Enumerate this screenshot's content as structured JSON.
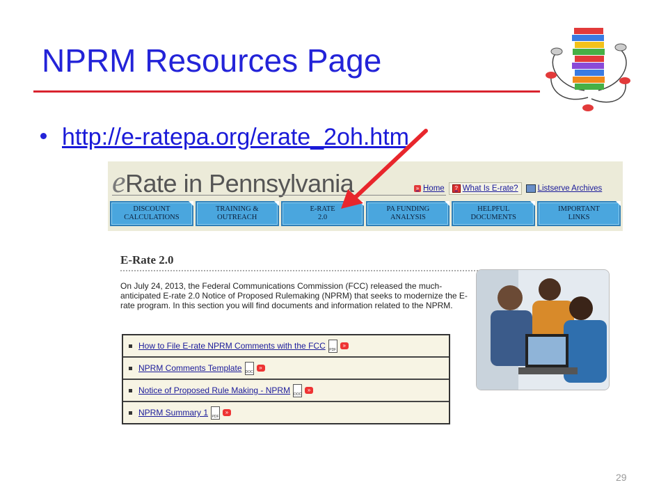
{
  "slide": {
    "title": "NPRM Resources Page",
    "bullet_link": "http://e-ratepa.org/erate_2oh.htm",
    "page_number": "29"
  },
  "site": {
    "logo_e": "e",
    "logo_rest": "Rate in Pennsylvania",
    "top_links": {
      "home": "Home",
      "what_is": "What Is E-rate?",
      "listserve": "Listserve Archives"
    },
    "nav": [
      "DISCOUNT\nCALCULATIONS",
      "TRAINING &\nOUTREACH",
      "E-RATE\n2.0",
      "PA FUNDING\nANALYSIS",
      "HELPFUL\nDOCUMENTS",
      "IMPORTANT\nLINKS"
    ],
    "heading": "E-Rate 2.0",
    "intro": "On July 24, 2013, the Federal Communications Commission (FCC) released the much-anticipated E-rate 2.0 Notice of Proposed Rulemaking (NPRM) that seeks to modernize the E-rate program. In this section you will find documents and information related to the NPRM.",
    "documents": [
      {
        "label": "How to File E-rate NPRM Comments with the FCC",
        "type": "PDF"
      },
      {
        "label": "NPRM Comments Template",
        "type": "DOC"
      },
      {
        "label": "Notice of Proposed Rule Making - NPRM",
        "type": "DOC"
      },
      {
        "label": "NPRM Summary 1",
        "type": "PDF"
      }
    ]
  },
  "colors": {
    "title": "#2323d8",
    "rule": "#d9232e",
    "nav_tab": "#4aa6de",
    "arrow": "#e8262c"
  }
}
